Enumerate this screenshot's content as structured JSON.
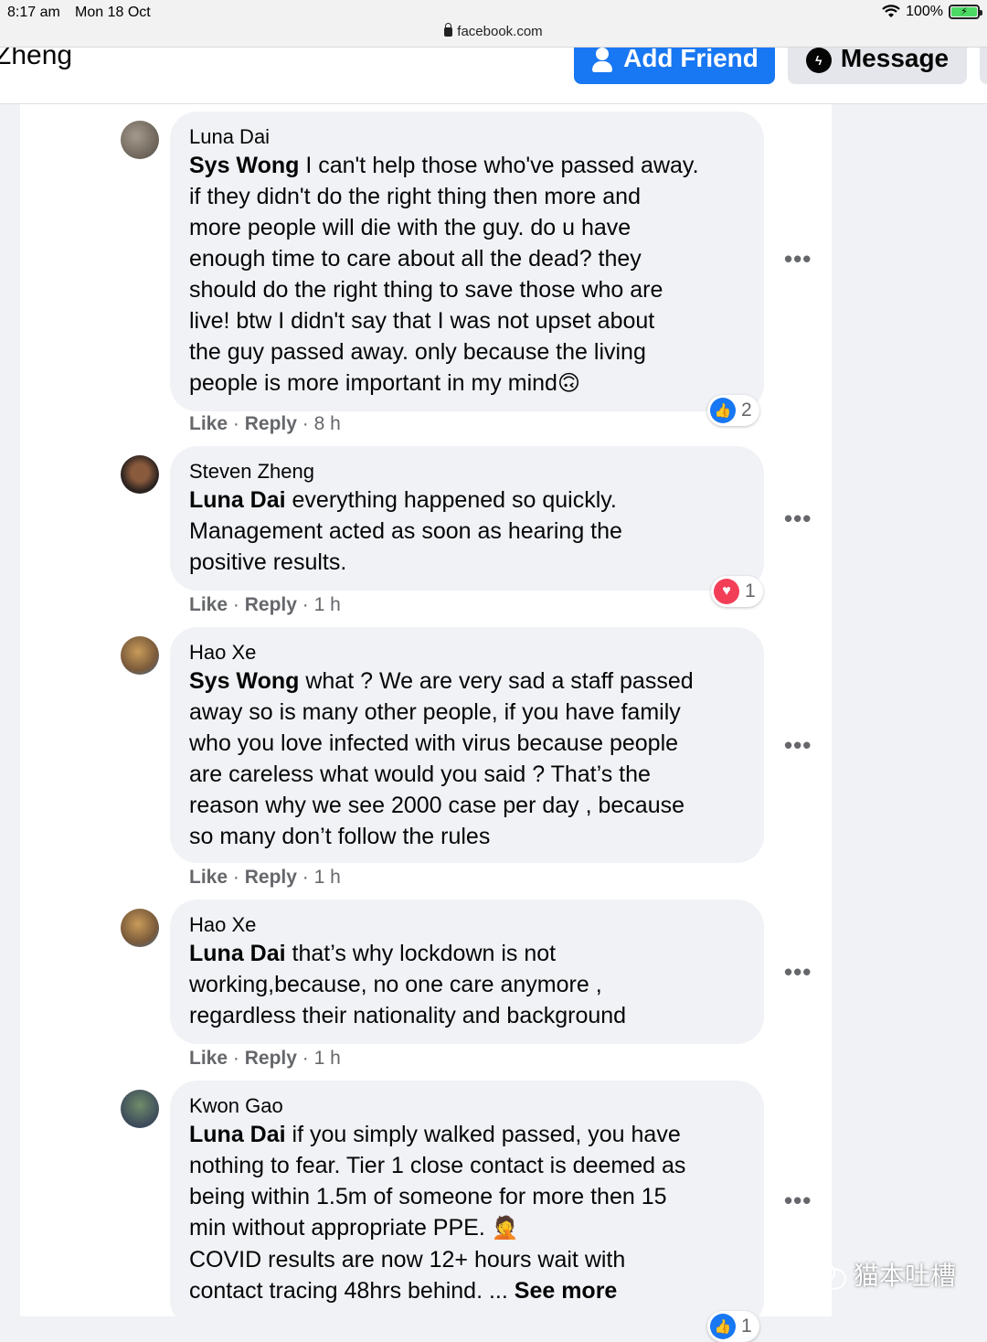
{
  "status_bar": {
    "time": "8:17 am",
    "date": "Mon 18 Oct",
    "battery": "100%",
    "url": "facebook.com"
  },
  "profile": {
    "name": "Zheng",
    "add_friend_label": "Add Friend",
    "message_label": "Message"
  },
  "comments": [
    {
      "author": "Luna Dai",
      "mention": "Sys Wong",
      "lines": [
        " I can't help those who've passed away.",
        "if they didn't do the right thing then more and",
        "more people will die with the guy. do u have",
        "enough time to care about all the dead? they",
        "should do the right thing to save those who are",
        "live! btw I didn't say that I was not upset about",
        "the guy passed away. only because the living",
        "people is more important in my mind"
      ],
      "emoji": "🙃",
      "like_label": "Like",
      "reply_label": "Reply",
      "time": "8 h",
      "reaction_type": "like",
      "reaction_count": "2"
    },
    {
      "author": "Steven Zheng",
      "mention": "Luna Dai",
      "lines": [
        " everything happened so quickly.",
        "Management acted as soon as hearing the",
        "positive results."
      ],
      "like_label": "Like",
      "reply_label": "Reply",
      "time": "1 h",
      "reaction_type": "love",
      "reaction_count": "1"
    },
    {
      "author": "Hao Xe",
      "mention": "Sys Wong",
      "lines": [
        " what ? We are very sad a staff passed",
        "away so is many other people, if you have family",
        "who you love infected with virus because people",
        "are careless what would you said ? That’s the",
        "reason why we see 2000 case per day , because",
        "so many don’t follow the rules"
      ],
      "like_label": "Like",
      "reply_label": "Reply",
      "time": "1 h"
    },
    {
      "author": "Hao Xe",
      "mention": "Luna Dai",
      "lines": [
        " that’s why lockdown is not",
        "working,because, no one care anymore ,",
        "regardless their nationality and background"
      ],
      "like_label": "Like",
      "reply_label": "Reply",
      "time": "1 h"
    },
    {
      "author": "Kwon Gao",
      "mention": "Luna Dai",
      "lines": [
        " if you simply walked passed, you have",
        "nothing to fear. Tier 1 close contact is deemed as",
        "being within 1.5m of someone for more then 15",
        "min without appropriate PPE. ",
        "COVID results are now 12+ hours wait with",
        "contact tracing 48hrs behind. ... "
      ],
      "emoji": "🤦",
      "see_more": "See more",
      "reaction_count": "1"
    }
  ],
  "more_label": "•••",
  "sep": "·",
  "watermark": "猫本吐槽"
}
